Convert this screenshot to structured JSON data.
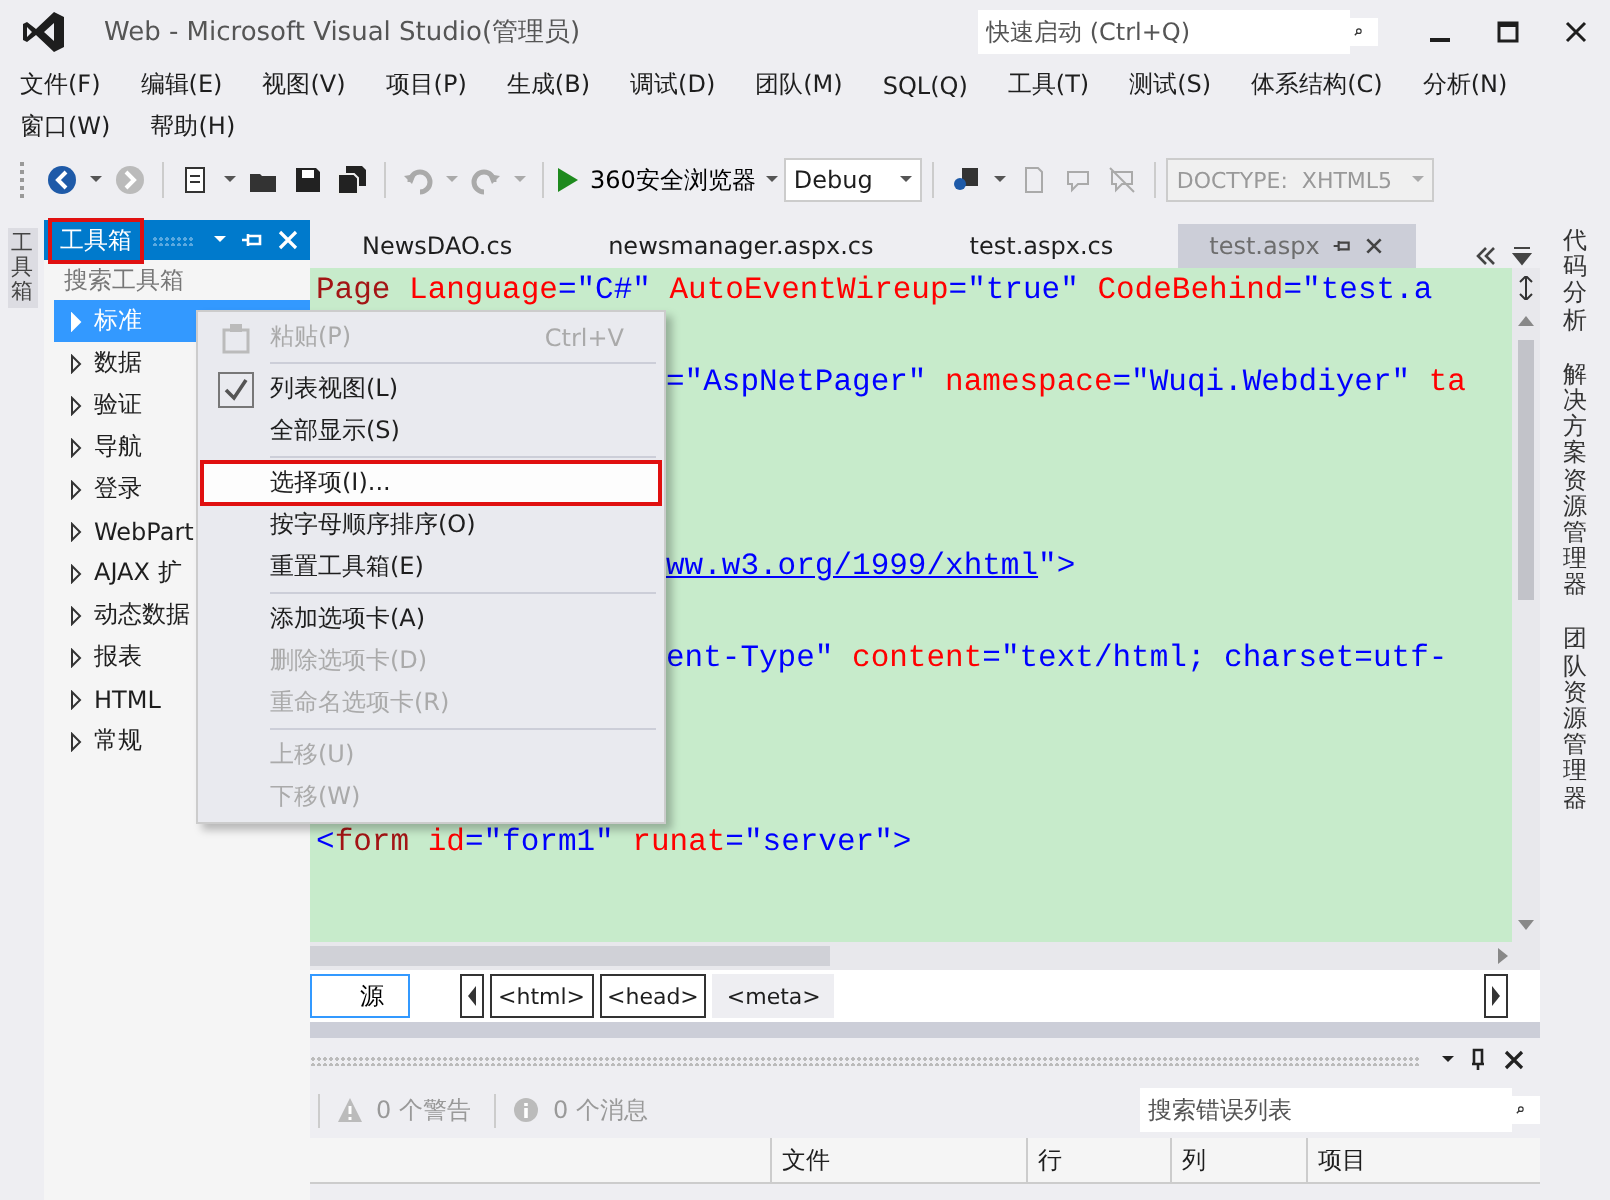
{
  "window": {
    "title": "Web - Microsoft Visual Studio(管理员)",
    "quick_launch": {
      "placeholder": "快速启动 (Ctrl+Q)"
    }
  },
  "menu_bar": {
    "rows": [
      [
        "文件(F)",
        "编辑(E)",
        "视图(V)",
        "项目(P)",
        "生成(B)",
        "调试(D)",
        "团队(M)",
        "SQL(Q)",
        "工具(T)",
        "测试(S)",
        "体系结构(C)",
        "分析(N)"
      ],
      [
        "窗口(W)",
        "帮助(H)"
      ]
    ]
  },
  "toolbar": {
    "run_target": "360安全浏览器",
    "configuration": "Debug",
    "doctype": {
      "value": "DOCTYPE:  XHTML5",
      "disabled": true
    }
  },
  "left_strip": {
    "tab": "工具箱"
  },
  "toolbox": {
    "title": "工具箱",
    "highlighted": true,
    "search": {
      "placeholder": "搜索工具箱"
    },
    "items": [
      {
        "label": "标准",
        "selected": true
      },
      {
        "label": "数据",
        "selected": false
      },
      {
        "label": "验证",
        "selected": false
      },
      {
        "label": "导航",
        "selected": false
      },
      {
        "label": "登录",
        "selected": false
      },
      {
        "label": "WebPart",
        "selected": false
      },
      {
        "label": "AJAX 扩",
        "selected": false
      },
      {
        "label": "动态数据",
        "selected": false
      },
      {
        "label": "报表",
        "selected": false
      },
      {
        "label": "HTML",
        "selected": false
      },
      {
        "label": "常规",
        "selected": false
      }
    ]
  },
  "context_menu": {
    "items": [
      {
        "kind": "item",
        "label": "粘贴(P)",
        "shortcut": "Ctrl+V",
        "disabled": true,
        "checked": false,
        "selected": false,
        "highlighted": false
      },
      {
        "kind": "separator"
      },
      {
        "kind": "item",
        "label": "列表视图(L)",
        "disabled": false,
        "checked": true,
        "selected": false,
        "highlighted": false
      },
      {
        "kind": "item",
        "label": "全部显示(S)",
        "disabled": false,
        "checked": false,
        "selected": false,
        "highlighted": false
      },
      {
        "kind": "separator"
      },
      {
        "kind": "item",
        "label": "选择项(I)...",
        "disabled": false,
        "checked": false,
        "selected": true,
        "highlighted": true
      },
      {
        "kind": "item",
        "label": "按字母顺序排序(O)",
        "disabled": false,
        "checked": false,
        "selected": false,
        "highlighted": false
      },
      {
        "kind": "item",
        "label": "重置工具箱(E)",
        "disabled": false,
        "checked": false,
        "selected": false,
        "highlighted": false
      },
      {
        "kind": "separator"
      },
      {
        "kind": "item",
        "label": "添加选项卡(A)",
        "disabled": false,
        "checked": false,
        "selected": false,
        "highlighted": false
      },
      {
        "kind": "item",
        "label": "删除选项卡(D)",
        "disabled": true,
        "checked": false,
        "selected": false,
        "highlighted": false
      },
      {
        "kind": "item",
        "label": "重命名选项卡(R)",
        "disabled": true,
        "checked": false,
        "selected": false,
        "highlighted": false
      },
      {
        "kind": "separator"
      },
      {
        "kind": "item",
        "label": "上移(U)",
        "disabled": true,
        "checked": false,
        "selected": false,
        "highlighted": false
      },
      {
        "kind": "item",
        "label": "下移(W)",
        "disabled": true,
        "checked": false,
        "selected": false,
        "highlighted": false
      }
    ]
  },
  "editor_tabs": [
    {
      "label": "NewsDAO.cs",
      "selected": false
    },
    {
      "label": "newsmanager.aspx.cs",
      "selected": false
    },
    {
      "label": "test.aspx.cs",
      "selected": false
    },
    {
      "label": "test.aspx",
      "selected": true
    }
  ],
  "code_lines": [
    {
      "tokens": [
        {
          "kind": "tag",
          "text": "Page"
        },
        {
          "kind": "attr",
          "text": " Language"
        },
        {
          "kind": "value",
          "text": "=\"C#\""
        },
        {
          "kind": "attr",
          "text": " AutoEventWireup"
        },
        {
          "kind": "value",
          "text": "=\"true\""
        },
        {
          "kind": "attr",
          "text": " CodeBehind"
        },
        {
          "kind": "value",
          "text": "=\"test.a"
        }
      ]
    },
    {
      "tokens": [
        {
          "kind": "value",
          "text": "=\"AspNetPager\""
        },
        {
          "kind": "attr",
          "text": " namespace"
        },
        {
          "kind": "value",
          "text": "=\"Wuqi.Webdiyer\""
        },
        {
          "kind": "attr",
          "text": " ta"
        }
      ]
    },
    {
      "tokens": [
        {
          "kind": "link",
          "text": "ww.w3.org/1999/xhtml"
        },
        {
          "kind": "value",
          "text": "\">"
        }
      ]
    },
    {
      "tokens": [
        {
          "kind": "value",
          "text": "ent-Type\""
        },
        {
          "kind": "attr",
          "text": " content"
        },
        {
          "kind": "value",
          "text": "=\"text/html; charset=utf-"
        }
      ]
    },
    {
      "tokens": [
        {
          "kind": "value",
          "text": "<"
        },
        {
          "kind": "tag",
          "text": "form"
        },
        {
          "kind": "attr",
          "text": " id"
        },
        {
          "kind": "value",
          "text": "=\"form1\""
        },
        {
          "kind": "attr",
          "text": " runat"
        },
        {
          "kind": "value",
          "text": "=\"server\""
        },
        {
          "kind": "value",
          "text": ">"
        }
      ]
    }
  ],
  "breadcrumb": {
    "view_button": "源",
    "items": [
      "<html>",
      "<head>",
      "<meta>"
    ]
  },
  "error_list": {
    "warnings": "0 个警告",
    "messages": "0 个消息",
    "search": {
      "placeholder": "搜索错误列表"
    },
    "columns": [
      "文件",
      "行",
      "列",
      "项目"
    ]
  },
  "right_strip": {
    "tabs": [
      "代码分析",
      "解决方案资源管理器",
      "团队资源管理器"
    ]
  }
}
